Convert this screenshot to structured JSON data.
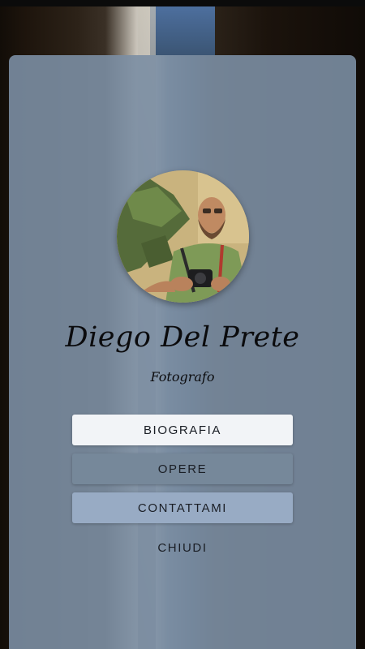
{
  "profile": {
    "name": "Diego Del Prete",
    "subtitle": "Fotografo",
    "avatar_icon": "profile-photo"
  },
  "menu": {
    "biografia": "BIOGRAFIA",
    "opere": "OPERE",
    "contattami": "CONTATTAMI",
    "chiudi": "CHIUDI"
  },
  "colors": {
    "panel": "#7b8ea3",
    "button_active": "#f2f4f7",
    "button_opere": "#76889a",
    "button_contattami": "#98abc4"
  }
}
